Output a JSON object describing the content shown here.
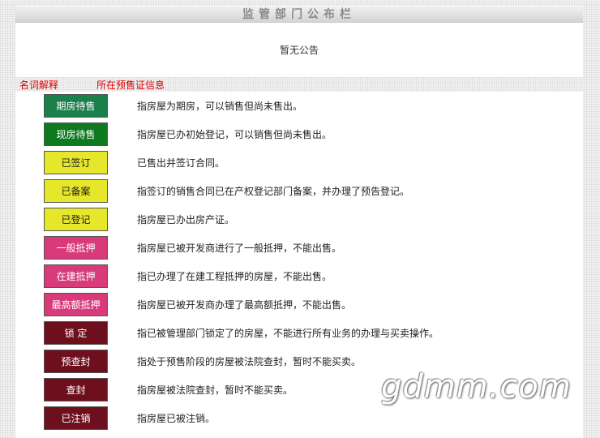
{
  "notice_board": {
    "title": "监管部门公布栏",
    "content": "暂无公告"
  },
  "links": {
    "glossary": "名词解释",
    "presale_info": "所在预售证信息"
  },
  "status_legend": [
    {
      "label": "期房待售",
      "description": "指房屋为期房，可以销售但尚未售出。",
      "bg": "#1a7f4a",
      "fg": "#ffffff"
    },
    {
      "label": "现房待售",
      "description": "指房屋已办初始登记，可以销售但尚未售出。",
      "bg": "#0e7a20",
      "fg": "#ffffff"
    },
    {
      "label": "已签订",
      "description": "已售出并签订合同。",
      "bg": "#e6e62a",
      "fg": "#222222"
    },
    {
      "label": "已备案",
      "description": "指签订的销售合同已在产权登记部门备案，并办理了预告登记。",
      "bg": "#e6e62a",
      "fg": "#222222"
    },
    {
      "label": "已登记",
      "description": "指房屋已办出房产证。",
      "bg": "#e6e62a",
      "fg": "#222222"
    },
    {
      "label": "一般抵押",
      "description": "指房屋已被开发商进行了一般抵押，不能出售。",
      "bg": "#d83a7a",
      "fg": "#ffffff"
    },
    {
      "label": "在建抵押",
      "description": "指已办理了在建工程抵押的房屋，不能出售。",
      "bg": "#d83a7a",
      "fg": "#ffffff"
    },
    {
      "label": "最高额抵押",
      "description": "指房屋已被开发商办理了最高额抵押，不能出售。",
      "bg": "#d83a7a",
      "fg": "#ffffff"
    },
    {
      "label": "锁 定",
      "description": "指已被管理部门锁定了的房屋，不能进行所有业务的办理与买卖操作。",
      "bg": "#6e0f1e",
      "fg": "#ffffff"
    },
    {
      "label": "预查封",
      "description": "指处于预售阶段的房屋被法院查封，暂时不能买卖。",
      "bg": "#6e0f1e",
      "fg": "#ffffff"
    },
    {
      "label": "查封",
      "description": "指房屋被法院查封，暂时不能买卖。",
      "bg": "#6e0f1e",
      "fg": "#ffffff"
    },
    {
      "label": "已注销",
      "description": "指房屋已被注销。",
      "bg": "#6e0f1e",
      "fg": "#ffffff"
    }
  ],
  "watermark": "gdmm.com"
}
